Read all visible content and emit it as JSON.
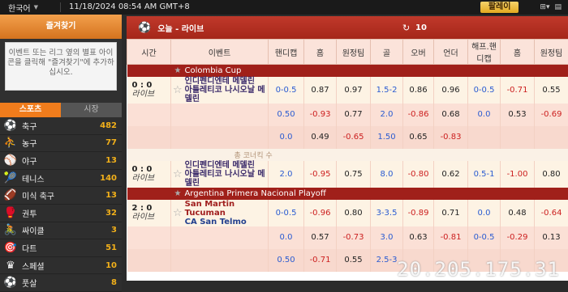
{
  "topbar": {
    "language": "한국어",
    "datetime": "11/18/2024 08:54 AM GMT+8",
    "wallet_button": "팔레이"
  },
  "sidebar": {
    "favorites_title": "즐겨찾기",
    "favorites_hint": "이벤트 또는 리그 옆의 별표 아이콘을 클릭해 \"즐겨찾기\"에 추가하십시오.",
    "tabs": [
      "스포츠",
      "시장"
    ],
    "sports": [
      {
        "name": "축구",
        "count": "482",
        "icon": "soccer-icon"
      },
      {
        "name": "농구",
        "count": "77",
        "icon": "basketball-icon"
      },
      {
        "name": "야구",
        "count": "13",
        "icon": "baseball-icon"
      },
      {
        "name": "테니스",
        "count": "140",
        "icon": "tennis-icon"
      },
      {
        "name": "미식 축구",
        "count": "13",
        "icon": "football-icon"
      },
      {
        "name": "권투",
        "count": "32",
        "icon": "boxing-icon"
      },
      {
        "name": "싸이클",
        "count": "3",
        "icon": "cycling-icon"
      },
      {
        "name": "다트",
        "count": "51",
        "icon": "darts-icon"
      },
      {
        "name": "스페셜",
        "count": "10",
        "icon": "special-icon"
      },
      {
        "name": "풋살",
        "count": "8",
        "icon": "futsal-icon"
      }
    ]
  },
  "main": {
    "title": "오늘 - 라이브",
    "count": "10",
    "columns": [
      "시간",
      "이벤트",
      "핸디캡",
      "홈",
      "원정팀",
      "골",
      "오버",
      "언더",
      "해프.핸디캡",
      "홈",
      "원정팀"
    ],
    "leagues": [
      {
        "name": "Colombia Cup",
        "matches": [
          {
            "score": "0 : 0",
            "status": "라이브",
            "teams": [
              "인디펜디엔테 메델린",
              "아틀레티코 나시오날 메델린"
            ],
            "rows": [
              [
                "0-0.5",
                "0.87",
                "0.97",
                "1.5-2",
                "0.86",
                "0.96",
                "0-0.5",
                "-0.71",
                "0.55"
              ],
              [
                "0.50",
                "-0.93",
                "0.77",
                "2.0",
                "-0.86",
                "0.68",
                "0.0",
                "0.53",
                "-0.69"
              ],
              [
                "0.0",
                "0.49",
                "-0.65",
                "1.50",
                "0.65",
                "-0.83",
                "",
                "",
                ""
              ]
            ]
          }
        ]
      },
      {
        "name": "총 코너킥 수",
        "matches": [
          {
            "score": "0 : 0",
            "status": "라이브",
            "teams": [
              "인디펜디엔테 메델린",
              "아틀레티코 나시오날 메델린"
            ],
            "rows": [
              [
                "2.0",
                "-0.95",
                "0.75",
                "8.0",
                "-0.80",
                "0.62",
                "0.5-1",
                "-1.00",
                "0.80"
              ]
            ]
          }
        ]
      },
      {
        "name": "Argentina Primera Nacional Playoff",
        "matches": [
          {
            "score": "2 : 0",
            "status": "라이브",
            "teams": [
              "San Martin Tucuman",
              "CA San Telmo"
            ],
            "rows": [
              [
                "0-0.5",
                "-0.96",
                "0.80",
                "3-3.5",
                "-0.89",
                "0.71",
                "0.0",
                "0.48",
                "-0.64"
              ],
              [
                "0.0",
                "0.57",
                "-0.73",
                "3.0",
                "0.63",
                "-0.81",
                "0-0.5",
                "-0.29",
                "0.13"
              ],
              [
                "0.50",
                "-0.71",
                "0.55",
                "2.5-3",
                "",
                "",
                "",
                "",
                ""
              ]
            ]
          }
        ]
      }
    ]
  },
  "watermark": "20.205.175.31"
}
